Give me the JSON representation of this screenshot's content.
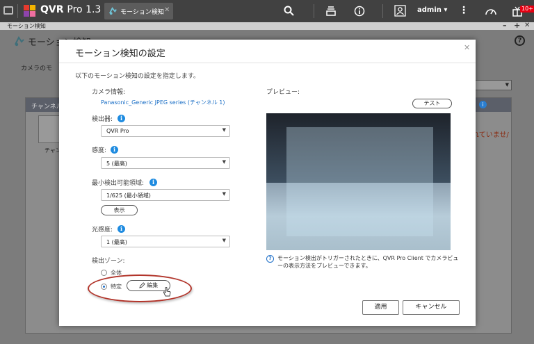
{
  "app": {
    "name": "QVR",
    "version": "Pro 1.3",
    "tab_label": "モーション検知",
    "user": "admin",
    "user_caret": "▾",
    "notification_count": "10+"
  },
  "window": {
    "title": "モーション検知",
    "page_heading": "モーション検知",
    "min_label": "–",
    "add_label": "+",
    "close_label": "✕"
  },
  "background": {
    "camera_label": "カメラのモ",
    "channel_header": "チャンネル",
    "channel_item": "チャン",
    "error_text": "れていませ/",
    "info_glyph": "i",
    "help_glyph": "?"
  },
  "dialog": {
    "title": "モーション検知の設定",
    "close_glyph": "✕",
    "subtitle": "以下のモーション検知の設定を指定します。",
    "camera_info_label": "カメラ情報:",
    "camera_info_value": "Panasonic_Generic JPEG series (チャンネル 1)",
    "detector_label": "検出器:",
    "detector_value": "QVR Pro",
    "sensitivity_label": "感度:",
    "sensitivity_value": "5 (最高)",
    "min_area_label": "最小検出可能領域:",
    "min_area_value": "1/625 (最小領域)",
    "show_button": "表示",
    "light_label": "光感度:",
    "light_value": "1 (最高)",
    "zone_label": "検出ゾーン:",
    "zone_all": "全体",
    "zone_specific": "特定",
    "edit_button": "編集",
    "preview_label": "プレビュー:",
    "test_button": "テスト",
    "note_icon": "?",
    "note_text": "モーション検出がトリガーされたときに、QVR Pro Client でカメラビューの表示方法をプレビューできます。",
    "apply_button": "適用",
    "cancel_button": "キャンセル",
    "info_glyph": "i",
    "caret_glyph": "▼"
  }
}
